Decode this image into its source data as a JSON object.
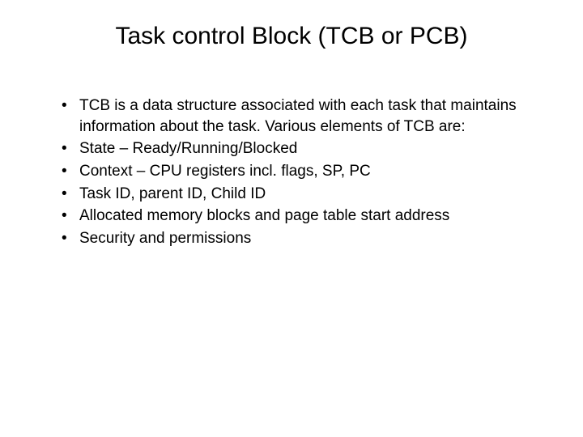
{
  "title": "Task control Block (TCB or PCB)",
  "bullets": [
    "TCB is a data structure associated with each task that maintains information about the task. Various elements of TCB are:",
    "State – Ready/Running/Blocked",
    "Context – CPU registers incl. flags, SP, PC",
    "Task ID, parent ID, Child ID",
    "Allocated memory blocks and page table start address",
    "Security and permissions"
  ]
}
